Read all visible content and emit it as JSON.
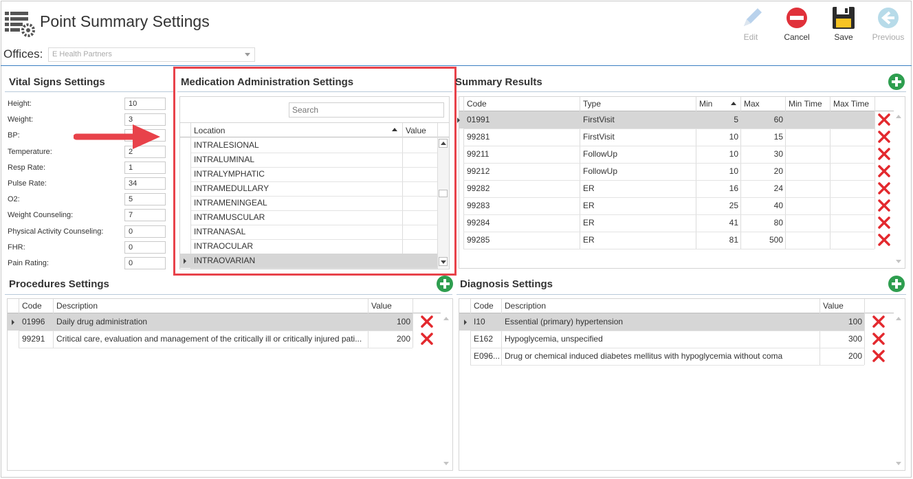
{
  "window": {
    "title": "Point Summary Settings"
  },
  "toolbar": {
    "edit_label": "Edit",
    "cancel_label": "Cancel",
    "save_label": "Save",
    "previous_label": "Previous"
  },
  "offices": {
    "label": "Offices:",
    "value": "E Health Partners"
  },
  "vitals": {
    "title": "Vital Signs Settings",
    "items": [
      {
        "label": "Height:",
        "value": "10"
      },
      {
        "label": "Weight:",
        "value": "3"
      },
      {
        "label": "BP:",
        "value": ""
      },
      {
        "label": "Temperature:",
        "value": "2"
      },
      {
        "label": "Resp Rate:",
        "value": "1"
      },
      {
        "label": "Pulse Rate:",
        "value": "34"
      },
      {
        "label": "O2:",
        "value": "5"
      },
      {
        "label": "Weight Counseling:",
        "value": "7"
      },
      {
        "label": "Physical Activity Counseling:",
        "value": "0"
      },
      {
        "label": "FHR:",
        "value": "0"
      },
      {
        "label": "Pain Rating:",
        "value": "0"
      }
    ]
  },
  "medication": {
    "title": "Medication Administration Settings",
    "search_placeholder": "Search",
    "columns": {
      "location": "Location",
      "value": "Value"
    },
    "rows": [
      "INTRALESIONAL",
      "INTRALUMINAL",
      "INTRALYMPHATIC",
      "INTRAMEDULLARY",
      "INTRAMENINGEAL",
      "INTRAMUSCULAR",
      "INTRANASAL",
      "INTRAOCULAR",
      "INTRAOVARIAN"
    ]
  },
  "summary": {
    "title": "Summary Results",
    "columns": {
      "code": "Code",
      "type": "Type",
      "min": "Min",
      "max": "Max",
      "min_time": "Min Time",
      "max_time": "Max Time"
    },
    "rows": [
      {
        "code": "01991",
        "type": "FirstVisit",
        "min": "5",
        "max": "60"
      },
      {
        "code": "99281",
        "type": "FirstVisit",
        "min": "10",
        "max": "15"
      },
      {
        "code": "99211",
        "type": "FollowUp",
        "min": "10",
        "max": "30"
      },
      {
        "code": "99212",
        "type": "FollowUp",
        "min": "10",
        "max": "20"
      },
      {
        "code": "99282",
        "type": "ER",
        "min": "16",
        "max": "24"
      },
      {
        "code": "99283",
        "type": "ER",
        "min": "25",
        "max": "40"
      },
      {
        "code": "99284",
        "type": "ER",
        "min": "41",
        "max": "80"
      },
      {
        "code": "99285",
        "type": "ER",
        "min": "81",
        "max": "500"
      }
    ]
  },
  "procedures": {
    "title": "Procedures Settings",
    "columns": {
      "code": "Code",
      "description": "Description",
      "value": "Value"
    },
    "rows": [
      {
        "code": "01996",
        "description": "Daily drug administration",
        "value": "100"
      },
      {
        "code": "99291",
        "description": "Critical care, evaluation and management of the critically ill or critically injured pati...",
        "value": "200"
      }
    ]
  },
  "diagnosis": {
    "title": "Diagnosis Settings",
    "columns": {
      "code": "Code",
      "description": "Description",
      "value": "Value"
    },
    "rows": [
      {
        "code": "I10",
        "description": "Essential (primary) hypertension",
        "value": "100"
      },
      {
        "code": "E162",
        "description": "Hypoglycemia, unspecified",
        "value": "300"
      },
      {
        "code": "E096...",
        "description": "Drug or chemical induced diabetes mellitus with hypoglycemia without coma",
        "value": "200"
      }
    ]
  },
  "colors": {
    "accent": "#3a7fc1",
    "highlight": "#e8424a",
    "delete": "#e3292e",
    "add": "#2e9e4f",
    "selected_row": "#d6d6d6"
  }
}
